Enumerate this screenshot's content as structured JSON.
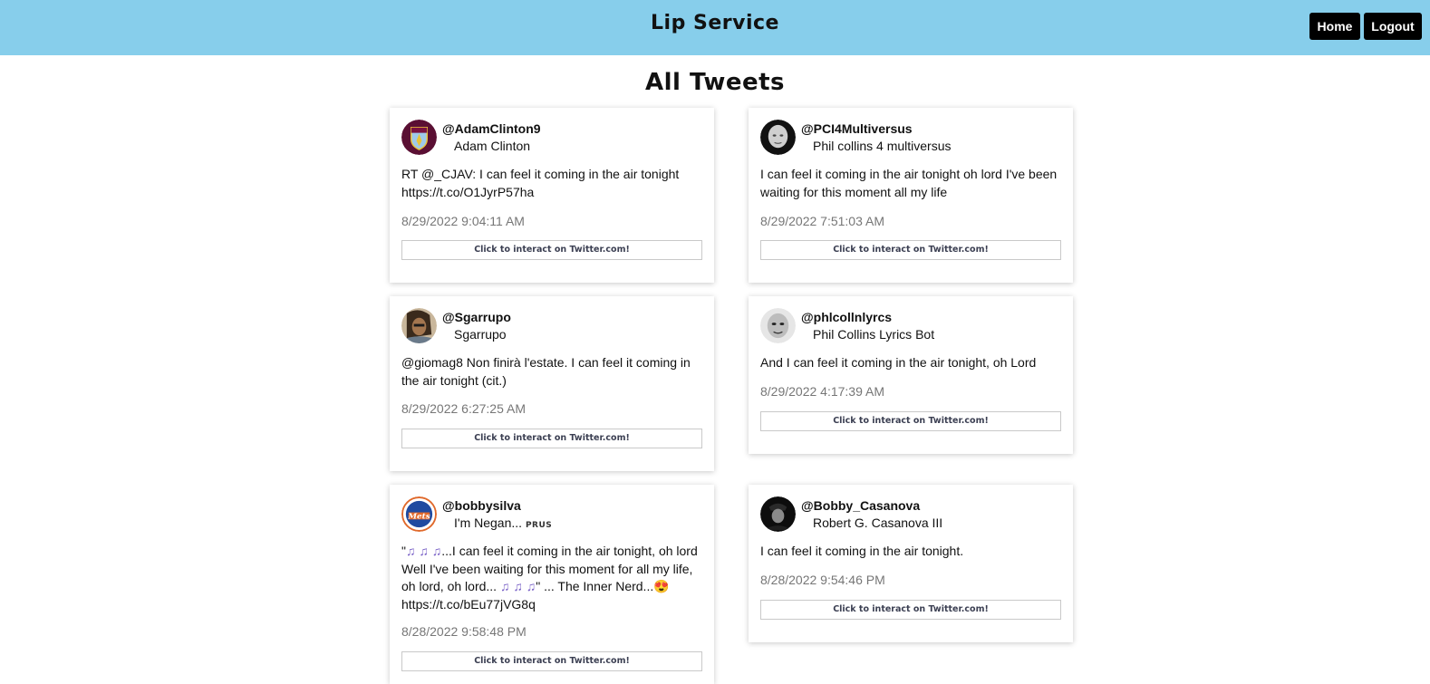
{
  "app": {
    "title": "Lip Service",
    "nav": {
      "home_label": "Home",
      "logout_label": "Logout"
    },
    "header_color": "#87ceeb"
  },
  "page": {
    "title": "All Tweets"
  },
  "interact_label": "Click to interact on Twitter.com!",
  "tweets": [
    {
      "handle": "@AdamClinton9",
      "name": "Adam Clinton",
      "text": "RT @_CJAV: I can feel it coming in the air tonight https://t.co/O1JyrP57ha",
      "timestamp": "8/29/2022 9:04:11 AM",
      "avatar_icon": "aston-villa-crest-icon"
    },
    {
      "handle": "@PCI4Multiversus",
      "name": "Phil collins 4 multiversus",
      "text": "I can feel it coming in the air tonight oh lord I've been waiting for this moment all my life",
      "timestamp": "8/29/2022 7:51:03 AM",
      "avatar_icon": "phil-collins-photo-icon"
    },
    {
      "handle": "@Sgarrupo",
      "name": "Sgarrupo",
      "text": "@giomag8 Non finirà l'estate. I can feel it coming in the air tonight (cit.)",
      "timestamp": "8/29/2022 6:27:25 AM",
      "avatar_icon": "person-photo-icon"
    },
    {
      "handle": "@phlcollnlyrcs",
      "name": "Phil Collins Lyrics Bot",
      "text": "And I can feel it coming in the air tonight, oh Lord",
      "timestamp": "8/29/2022 4:17:39 AM",
      "avatar_icon": "phil-collins-bw-photo-icon"
    },
    {
      "handle": "@bobbysilva",
      "name": "I'm Negan...",
      "name_badge": "PRUS",
      "text_parts": {
        "open": "\"",
        "notes": "♫ ♫ ♫",
        "middle": "...I can feel it coming in the air tonight, oh lord Well I've been waiting for this moment for all my life, oh lord, oh lord...",
        "close": "\" ... The Inner Nerd...",
        "emoji": "😍",
        "link": "https://t.co/bEu77jVG8q"
      },
      "timestamp": "8/28/2022 9:58:48 PM",
      "avatar_icon": "mets-logo-icon"
    },
    {
      "handle": "@Bobby_Casanova",
      "name": "Robert G. Casanova III",
      "text": "I can feel it coming in the air tonight.",
      "timestamp": "8/28/2022 9:54:46 PM",
      "avatar_icon": "dark-portrait-photo-icon"
    }
  ]
}
